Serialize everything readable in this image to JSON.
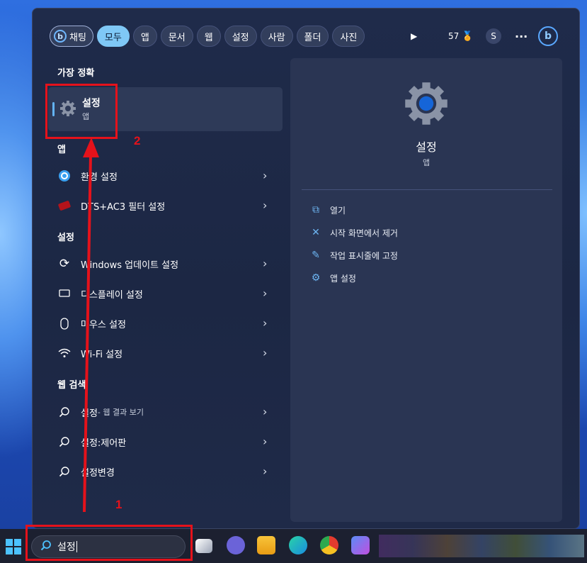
{
  "tabs": [
    {
      "label": "채팅",
      "active": false,
      "icon": "bing-icon"
    },
    {
      "label": "모두",
      "active": true
    },
    {
      "label": "앱"
    },
    {
      "label": "문서"
    },
    {
      "label": "웹"
    },
    {
      "label": "설정"
    },
    {
      "label": "사람"
    },
    {
      "label": "폴더"
    },
    {
      "label": "사진"
    }
  ],
  "toolbar": {
    "more_tabs_icon": "play-icon",
    "points": "57",
    "points_icon": "medal-icon",
    "profile_initial": "S",
    "more_icon": "ellipsis-icon",
    "bing_icon": "bing-icon"
  },
  "best_match": {
    "heading": "가장 정확",
    "title": "설정",
    "subtitle": "앱",
    "icon": "gear-icon"
  },
  "apps": {
    "heading": "앱",
    "items": [
      {
        "label": "환경 설정",
        "icon": "blue-gear-icon"
      },
      {
        "label": "DTS+AC3 필터 설정",
        "icon": "dts-app-icon"
      }
    ]
  },
  "settings": {
    "heading": "설정",
    "items": [
      {
        "label": "Windows 업데이트 설정",
        "icon": "refresh-icon"
      },
      {
        "label": "디스플레이 설정",
        "icon": "monitor-icon"
      },
      {
        "label": "마우스 설정",
        "icon": "mouse-icon"
      },
      {
        "label": "Wi-Fi 설정",
        "icon": "wifi-icon"
      }
    ]
  },
  "web": {
    "heading": "웹 검색",
    "items": [
      {
        "label": "설정",
        "suffix": " - 웹 결과 보기",
        "icon": "search-icon"
      },
      {
        "label": "설정:제어판",
        "suffix": "",
        "icon": "search-icon"
      },
      {
        "label": "설정변경",
        "suffix": "",
        "icon": "search-icon"
      }
    ]
  },
  "preview": {
    "title": "설정",
    "subtitle": "앱",
    "actions": [
      {
        "label": "열기",
        "icon": "open-external-icon"
      },
      {
        "label": "시작 화면에서 제거",
        "icon": "unpin-icon"
      },
      {
        "label": "작업 표시줄에 고정",
        "icon": "pin-icon"
      },
      {
        "label": "앱 설정",
        "icon": "gear-icon"
      }
    ]
  },
  "taskbar": {
    "search_value": "설정",
    "icons": [
      "start-icon",
      "task-view-icon",
      "chat-icon",
      "file-explorer-icon",
      "edge-icon",
      "chrome-icon",
      "copilot-icon"
    ]
  },
  "annotations": {
    "step1": "1",
    "step2": "2"
  },
  "colors": {
    "accent": "#7fc8f6",
    "annotation": "#e5121b"
  }
}
